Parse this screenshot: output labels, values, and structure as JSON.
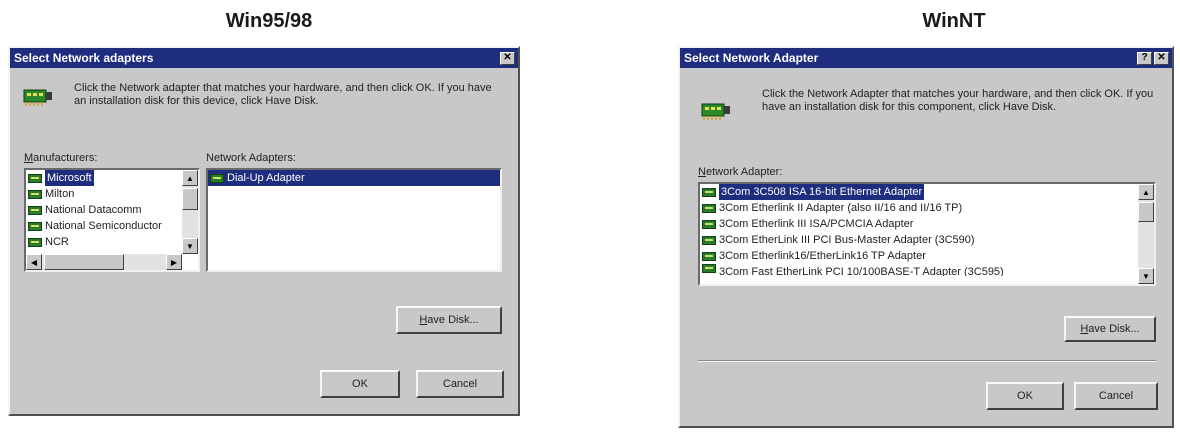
{
  "headings": {
    "left": "Win95/98",
    "right": "WinNT"
  },
  "win95": {
    "title": "Select Network adapters",
    "close_glyph": "✕",
    "description": "Click the Network adapter that matches your hardware, and then click OK. If you have an installation disk for this device, click Have Disk.",
    "manufacturers_label_underlined": "M",
    "manufacturers_label_rest": "anufacturers:",
    "manufacturers": [
      "Microsoft",
      "Milton",
      "National Datacomm",
      "National Semiconductor",
      "NCR"
    ],
    "selected_manufacturer": "Microsoft",
    "adapters_label": "Network Adapters:",
    "adapters": [
      "Dial-Up Adapter"
    ],
    "have_disk_underlined": "H",
    "have_disk_rest": "ave Disk...",
    "ok": "OK",
    "cancel": "Cancel"
  },
  "winnt": {
    "title": "Select Network Adapter",
    "help_glyph": "?",
    "close_glyph": "✕",
    "description": "Click the Network Adapter that matches your hardware, and then click OK. If you have an installation disk for this component, click Have Disk.",
    "adapter_label_underlined": "N",
    "adapter_label_rest": "etwork Adapter:",
    "adapters": [
      "3Com 3C508 ISA 16-bit Ethernet Adapter",
      "3Com Etherlink II Adapter (also II/16 and II/16 TP)",
      "3Com Etherlink III ISA/PCMCIA Adapter",
      "3Com EtherLink III PCI Bus-Master Adapter (3C590)",
      "3Com Etherlink16/EtherLink16 TP Adapter",
      "3Com Fast EtherLink PCI 10/100BASE-T Adapter (3C595)"
    ],
    "selected_adapter": "3Com 3C508 ISA 16-bit Ethernet Adapter",
    "have_disk_underlined": "H",
    "have_disk_rest": "ave Disk...",
    "ok": "OK",
    "cancel": "Cancel"
  },
  "colors": {
    "titlebar": "#1f2d7e",
    "dialog_face": "#c8c8c8",
    "selection": "#1f2d7e"
  },
  "icons": {
    "network": "network-card-icon",
    "list_item": "nic-icon"
  }
}
